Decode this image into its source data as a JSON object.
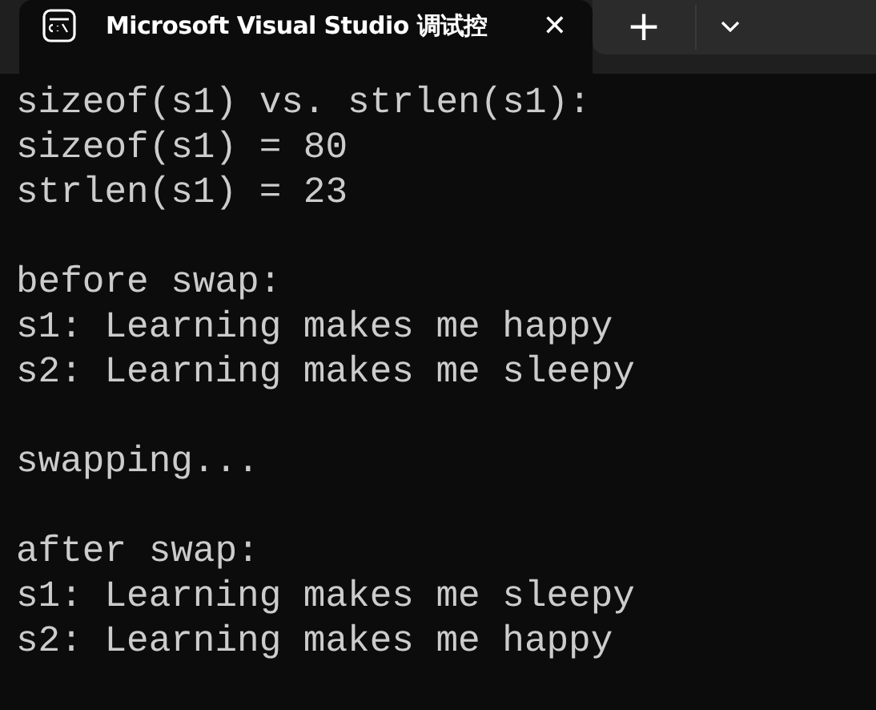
{
  "tab": {
    "title": "Microsoft Visual Studio 调试控",
    "selected": true,
    "close": "✕"
  },
  "new_tab": "+",
  "console": {
    "blocks": [
      [
        "sizeof(s1) vs. strlen(s1):",
        "sizeof(s1) = 80",
        "strlen(s1) = 23"
      ],
      [
        "before swap:",
        "s1: Learning makes me happy",
        "s2: Learning makes me sleepy"
      ],
      [
        "swapping..."
      ],
      [
        "after swap:",
        "s1: Learning makes me sleepy",
        "s2: Learning makes me happy"
      ]
    ]
  }
}
